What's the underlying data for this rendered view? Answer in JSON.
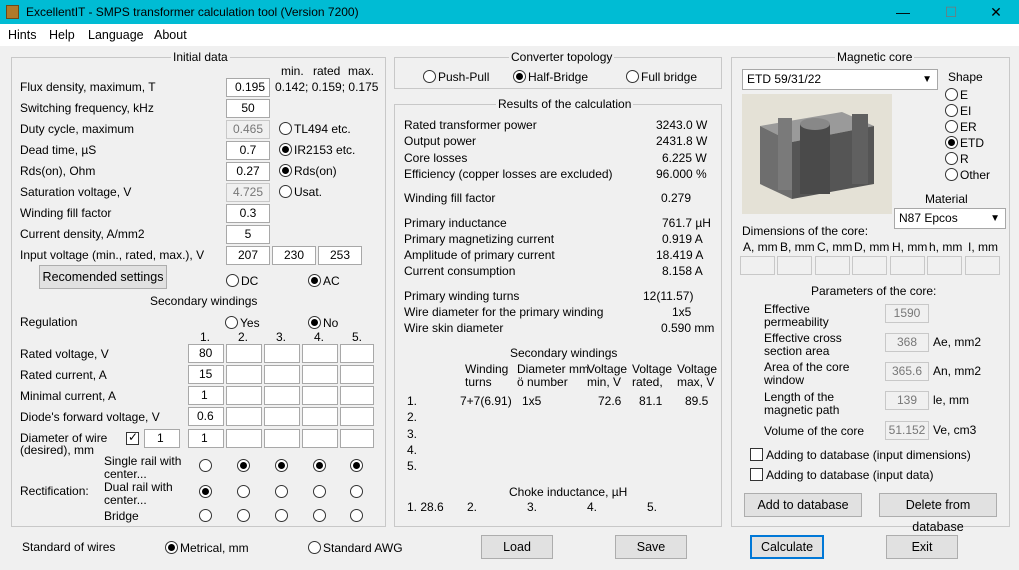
{
  "window": {
    "title": "ExcellentIT - SMPS transformer calculation tool (Version 7200)",
    "minimize": "—",
    "maximize": "☐",
    "close": "✕"
  },
  "menu": [
    "Hints",
    "Help",
    "Language",
    "About"
  ],
  "initial": {
    "title": "Initial data",
    "col_min": "min.",
    "col_rated": "rated",
    "col_max": "max.",
    "minmaxvals": "0.142; 0.159; 0.175",
    "rows": [
      {
        "label": "Flux density, maximum, T",
        "value": "0.195"
      },
      {
        "label": "Switching frequency, kHz",
        "value": "50"
      },
      {
        "label": "Duty cycle, maximum",
        "value": "0.465"
      },
      {
        "label": "Dead time, µS",
        "value": "0.7"
      },
      {
        "label": "Rds(on), Ohm",
        "value": "0.27"
      },
      {
        "label": "Saturation voltage, V",
        "value": "4.725"
      },
      {
        "label": "Winding fill factor",
        "value": "0.3"
      },
      {
        "label": "Current density, A/mm2",
        "value": "5"
      }
    ],
    "opt_tl494": "TL494 etc.",
    "opt_ir2153": "IR2153 etc.",
    "opt_rdson": "Rds(on)",
    "opt_usat": "Usat.",
    "input_label": "Input voltage (min., rated, max.), V",
    "vin_min": "207",
    "vin_rated": "230",
    "vin_max": "253",
    "recommended": "Recomended settings",
    "dc": "DC",
    "ac": "AC"
  },
  "secondary": {
    "title": "Secondary windings",
    "regulation": "Regulation",
    "yes": "Yes",
    "no": "No",
    "cols": [
      "1.",
      "2.",
      "3.",
      "4.",
      "5."
    ],
    "rated_voltage": "Rated voltage, V",
    "rated_voltage_v": "80",
    "rated_current": "Rated current, A",
    "rated_current_v": "15",
    "min_current": "Minimal current, A",
    "min_current_v": "1",
    "diode": "Diode's forward voltage, V",
    "diode_v": "0.6",
    "diam_label1": "Diameter of wire",
    "diam_label2": "(desired), mm",
    "diam_count": "1",
    "diam_v": "1",
    "rectification": "Rectification:",
    "single": "Single rail with",
    "single2": "center...",
    "dual": "Dual rail with",
    "dual2": "center...",
    "bridge": "Bridge"
  },
  "topology": {
    "title": "Converter topology",
    "pushpull": "Push-Pull",
    "halfbridge": "Half-Bridge",
    "fullbridge": "Full bridge"
  },
  "results": {
    "title": "Results of the calculation",
    "rows": [
      {
        "label": "Rated transformer power",
        "value": "3243.0 W"
      },
      {
        "label": "Output power",
        "value": "2431.8 W"
      },
      {
        "label": "Core losses",
        "value": "6.225 W"
      },
      {
        "label": "Efficiency (copper losses are excluded)",
        "value": "96.000 %"
      },
      {
        "label": "Winding fill factor",
        "value": "0.279"
      },
      {
        "label": "Primary inductance",
        "value": "761.7 µH"
      },
      {
        "label": "Primary magnetizing current",
        "value": "0.919 A"
      },
      {
        "label": "Amplitude of primary current",
        "value": "18.419 A"
      },
      {
        "label": "Current consumption",
        "value": "8.158 A"
      },
      {
        "label": "Primary winding turns",
        "value": "12(11.57)"
      },
      {
        "label": "Wire diameter for the primary winding",
        "value": "1x5"
      },
      {
        "label": "Wire skin diameter",
        "value": "0.590 mm"
      }
    ],
    "sec_title": "Secondary windings",
    "h_turns1": "Winding",
    "h_turns2": "turns",
    "h_diam1": "Diameter mm",
    "h_diam2": "ö number",
    "h_vmin1": "Voltage",
    "h_vmin2": "min, V",
    "h_vrated1": "Voltage",
    "h_vrated2": "rated,",
    "h_vmax1": "Voltage",
    "h_vmax2": "max, V",
    "sec_rows": [
      {
        "n": "1.",
        "turns": "7+7(6.91)",
        "diam": "1x5",
        "vmin": "72.6",
        "vrated": "81.1",
        "vmax": "89.5"
      },
      {
        "n": "2."
      },
      {
        "n": "3."
      },
      {
        "n": "4."
      },
      {
        "n": "5."
      }
    ],
    "choke_title": "Choke inductance, µH",
    "choke": [
      "1. 28.6",
      "2.",
      "3.",
      "4.",
      "5."
    ]
  },
  "core": {
    "title": "Magnetic core",
    "selected": "ETD 59/31/22",
    "shape_title": "Shape",
    "shapes": [
      "E",
      "EI",
      "ER",
      "ETD",
      "R",
      "Other"
    ],
    "material_title": "Material",
    "material": "N87 Epcos",
    "dims_title": "Dimensions of the core:",
    "dims": [
      "A, mm",
      "B, mm",
      "C, mm",
      "D, mm",
      "H, mm",
      "h, mm",
      "I, mm"
    ],
    "params_title": "Parameters of the core:",
    "perm1": "Effective",
    "perm2": "permeability",
    "perm_v": "1590",
    "cs1": "Effective cross",
    "cs2": "section area",
    "cs_v": "368",
    "cs_u": "Ae, mm2",
    "win1": "Area of the core",
    "win2": "window",
    "win_v": "365.6",
    "win_u": "An, mm2",
    "len1": "Length of the",
    "len2": "magnetic path",
    "len_v": "139",
    "len_u": "le, mm",
    "vol": "Volume of the core",
    "vol_v": "51.152",
    "vol_u": "Ve, cm3",
    "add_dims": "Adding to database (input dimensions)",
    "add_data": "Adding to database (input data)",
    "add_btn": "Add to database",
    "del_btn": "Delete from database"
  },
  "bottom": {
    "wires": "Standard of wires",
    "metrical": "Metrical, mm",
    "awg": "Standard AWG",
    "load": "Load",
    "save": "Save",
    "calculate": "Calculate",
    "exit": "Exit"
  }
}
